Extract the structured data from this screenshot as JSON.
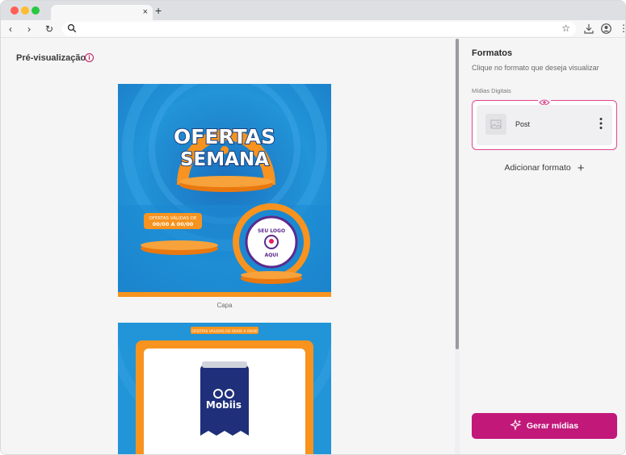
{
  "browser": {
    "tab_close": "×",
    "new_tab": "+",
    "nav_back": "‹",
    "nav_forward": "›",
    "nav_reload": "↻",
    "address_value": "",
    "menu_dots": "⋮"
  },
  "preview": {
    "title": "Pré-visualização",
    "info_glyph": "i",
    "card1": {
      "headline_top": "OFERTAS",
      "headline_bottom": "SEMANA",
      "validity_line1": "OFERTAS VÁLIDAS DE",
      "validity_line2": "00/00 A 00/00",
      "logo_line1": "SEU LOGO",
      "logo_line2": "AQUI"
    },
    "caption": "Capa",
    "card2": {
      "banner": "OFERTAS VÁLIDAS DE 00/00 A 00/00",
      "brand": "Mobiis"
    }
  },
  "panel": {
    "title": "Formatos",
    "subtitle": "Clique no formato que deseja visualizar",
    "group_label": "Mídias Digitais",
    "format_name": "Post",
    "add_format": "Adicionar formato",
    "add_glyph": "+",
    "generate": "Gerar mídias"
  },
  "colors": {
    "accent": "#c2187a",
    "selection_border": "#e0458f",
    "card_blue": "#1f88cf",
    "card_orange": "#f7931e"
  }
}
